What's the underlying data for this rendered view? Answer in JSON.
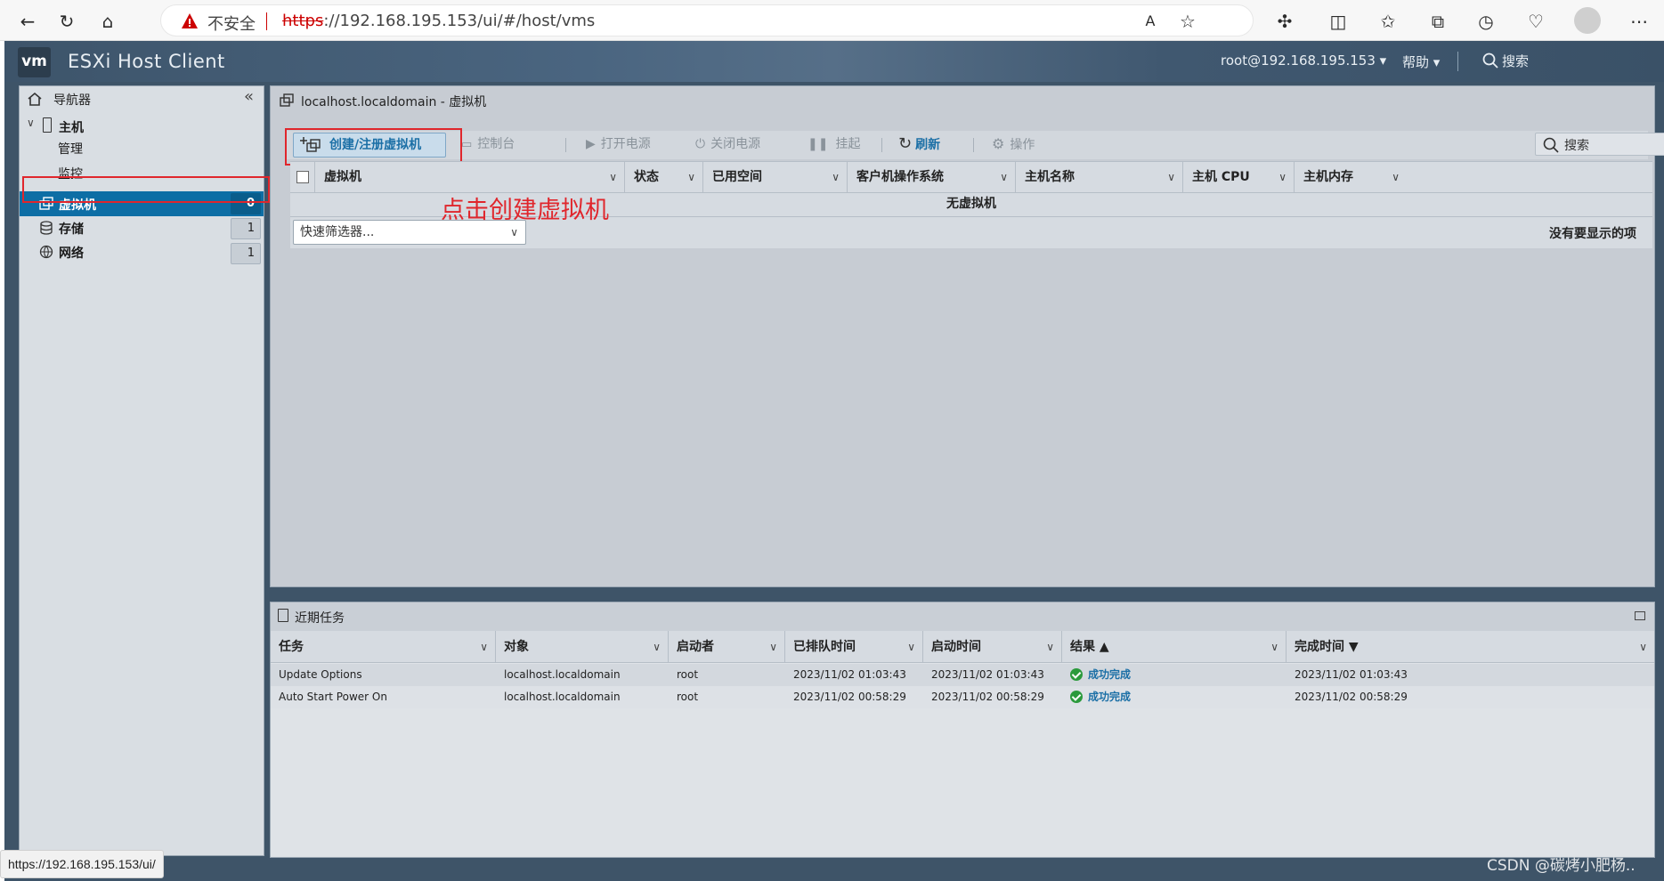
{
  "browser": {
    "insecure_label": "不安全",
    "url_https": "https",
    "url_rest": "://192.168.195.153/ui/#/host/vms",
    "status_url": "https://192.168.195.153/ui/"
  },
  "header": {
    "title": "ESXi Host Client",
    "logo": "vm",
    "user": "root@192.168.195.153 ▾",
    "help": "帮助 ▾",
    "search": "搜索"
  },
  "nav": {
    "title": "导航器",
    "host_label": "主机",
    "host_children": [
      "管理",
      "监控"
    ],
    "items": [
      {
        "label": "虚拟机",
        "count": "0"
      },
      {
        "label": "存储",
        "count": "1"
      },
      {
        "label": "网络",
        "count": "1"
      }
    ]
  },
  "main": {
    "breadcrumb": "localhost.localdomain - 虚拟机",
    "toolbar": {
      "create": "创建/注册虚拟机",
      "console": "控制台",
      "power_on": "打开电源",
      "power_off": "关闭电源",
      "suspend": "挂起",
      "refresh": "刷新",
      "actions": "操作",
      "search_placeholder": "搜索"
    },
    "columns": [
      "虚拟机",
      "状态",
      "已用空间",
      "客户机操作系统",
      "主机名称",
      "主机 CPU",
      "主机内存"
    ],
    "empty_message": "无虚拟机",
    "quick_filter": "快速筛选器...",
    "no_items": "没有要显示的项"
  },
  "annotation": "点击创建虚拟机",
  "tasks": {
    "title": "近期任务",
    "columns": [
      "任务",
      "对象",
      "启动者",
      "已排队时间",
      "启动时间",
      "结果 ▲",
      "完成时间 ▼"
    ],
    "rows": [
      [
        "Update Options",
        "localhost.localdomain",
        "root",
        "2023/11/02 01:03:43",
        "2023/11/02 01:03:43",
        "成功完成",
        "2023/11/02 01:03:43"
      ],
      [
        "Auto Start Power On",
        "localhost.localdomain",
        "root",
        "2023/11/02 00:58:29",
        "2023/11/02 00:58:29",
        "成功完成",
        "2023/11/02 00:58:29"
      ]
    ]
  },
  "watermark": "CSDN @碳烤小肥杨..",
  "colors": {
    "accent": "#0d6ea5",
    "annotation": "#e0262c",
    "success": "#2b9a3c"
  }
}
